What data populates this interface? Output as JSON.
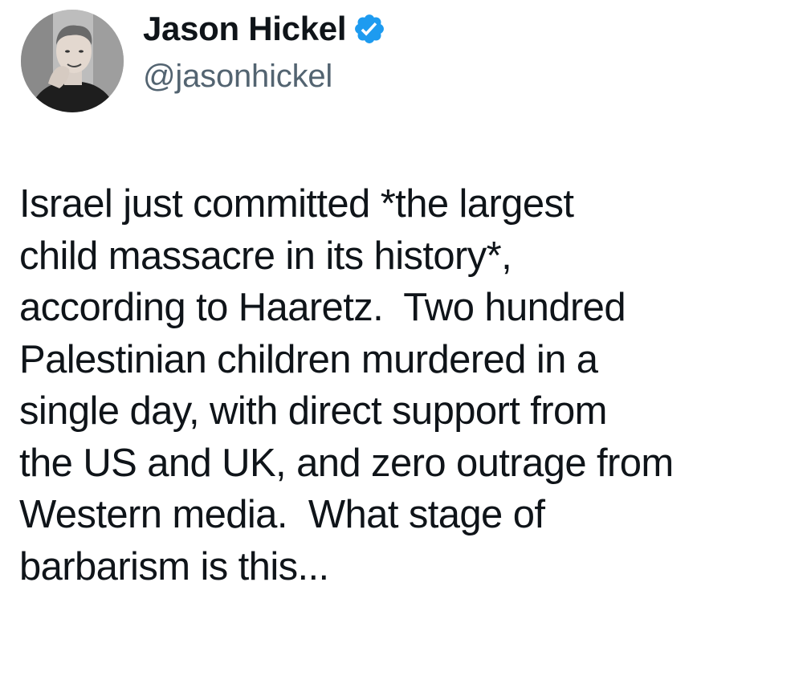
{
  "author": {
    "display_name": "Jason Hickel",
    "handle": "@jasonhickel",
    "verified": true,
    "verified_icon": "verified-badge-icon",
    "avatar": "profile-photo"
  },
  "tweet": {
    "lines": [
      "Israel just committed *the largest",
      "child massacre in its history*,",
      "according to Haaretz.  Two hundred",
      "Palestinian children murdered in a",
      "single day, with direct support from",
      "the US and UK, and zero outrage from",
      "Western media.  What stage of",
      "barbarism is this..."
    ]
  },
  "colors": {
    "text": "#0f1419",
    "secondary": "#536471",
    "verified": "#1d9bf0",
    "background": "#ffffff"
  }
}
